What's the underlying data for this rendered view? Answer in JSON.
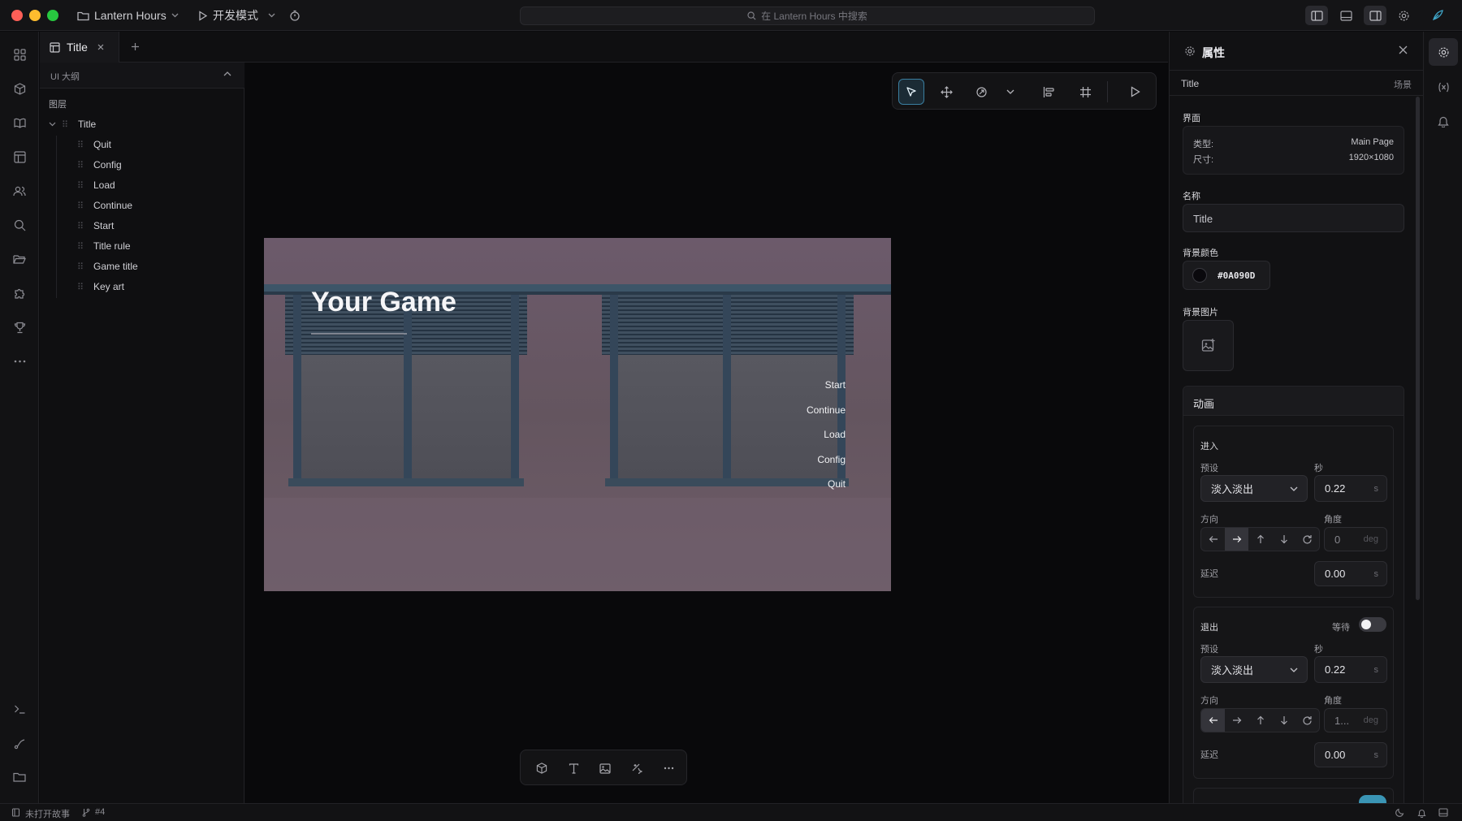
{
  "titlebar": {
    "project": "Lantern Hours",
    "mode": "开发模式",
    "search_placeholder": "在 Lantern Hours 中搜索"
  },
  "tabs": [
    {
      "label": "Title"
    }
  ],
  "outline": {
    "header": "UI 大纲",
    "section": "图层",
    "root": "Title",
    "children": [
      "Quit",
      "Config",
      "Load",
      "Continue",
      "Start",
      "Title rule",
      "Game title",
      "Key art"
    ]
  },
  "preview": {
    "title": "Your Game",
    "menu": [
      "Start",
      "Continue",
      "Load",
      "Config",
      "Quit"
    ]
  },
  "props": {
    "panel_title": "属性",
    "breadcrumb": "Title",
    "scope": "场景",
    "interface_label": "界面",
    "type_label": "类型:",
    "type_value": "Main Page",
    "size_label": "尺寸:",
    "size_value": "1920×1080",
    "name_label": "名称",
    "name_value": "Title",
    "bg_color_label": "背景颜色",
    "bg_color_value": "#0A090D",
    "bg_image_label": "背景图片",
    "anim_label": "动画",
    "enter": {
      "label": "进入",
      "preset_label": "预设",
      "seconds_label": "秒",
      "preset": "淡入淡出",
      "duration": "0.22",
      "unit_s": "s",
      "direction_label": "方向",
      "angle_label": "角度",
      "angle": "0",
      "unit_deg": "deg",
      "delay_label": "延迟",
      "delay": "0.00"
    },
    "exit": {
      "label": "退出",
      "wait_label": "等待",
      "preset_label": "预设",
      "seconds_label": "秒",
      "preset": "淡入淡出",
      "duration": "0.22",
      "unit_s": "s",
      "direction_label": "方向",
      "angle_label": "角度",
      "angle": "1...",
      "unit_deg": "deg",
      "delay_label": "延迟",
      "delay": "0.00"
    }
  },
  "status": {
    "story": "未打开故事",
    "branch": "#4"
  },
  "colors": {
    "accent": "#3a7ea0",
    "bg_swatch": "#0A090D",
    "toggle_on": "#3a95b5"
  }
}
